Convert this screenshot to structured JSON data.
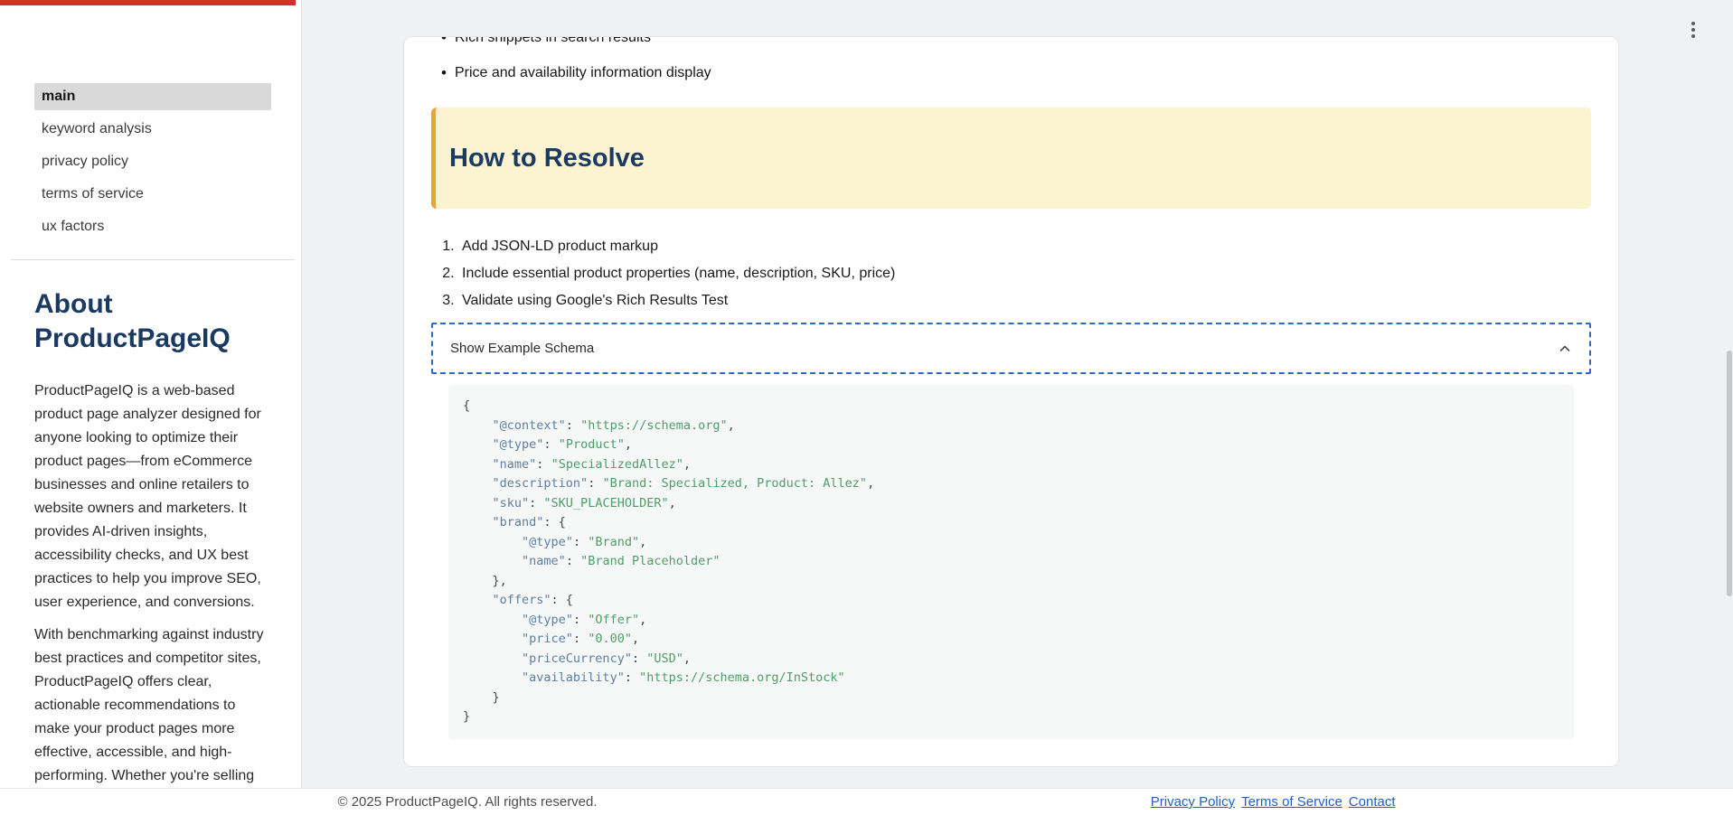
{
  "colors": {
    "accent_red": "#d32f2f",
    "heading_navy": "#1b3a61",
    "callout_bg": "#fcf3d1",
    "callout_border": "#efa22d",
    "toggle_dashed_blue": "#2e6bc0",
    "code_key": "#5b80a5",
    "code_string": "#4f9e68",
    "link_blue": "#2160c4"
  },
  "sidebar": {
    "nav": [
      {
        "label": "main",
        "active": true
      },
      {
        "label": "keyword analysis",
        "active": false
      },
      {
        "label": "privacy policy",
        "active": false
      },
      {
        "label": "terms of service",
        "active": false
      },
      {
        "label": "ux factors",
        "active": false
      }
    ],
    "about_title": "About ProductPageIQ",
    "about_p1": "ProductPageIQ is a web-based product page analyzer designed for anyone looking to optimize their product pages—from eCommerce businesses and online retailers to website owners and marketers. It provides AI-driven insights, accessibility checks, and UX best practices to help you improve SEO, user experience, and conversions.",
    "about_p2": "With benchmarking against industry best practices and competitor sites, ProductPageIQ offers clear, actionable recommendations to make your product pages more effective, accessible, and high-performing. Whether you're selling"
  },
  "main": {
    "partial_bullet": "Rich snippets in search results",
    "visible_bullet": "Price and availability information display",
    "bullet_glyph": "•",
    "callout_title": "How to Resolve",
    "steps": [
      "Add JSON-LD product markup",
      "Include essential product properties (name, description, SKU, price)",
      "Validate using Google's Rich Results Test"
    ],
    "toggle_label": "Show Example Schema",
    "code": {
      "lines": [
        [
          [
            "p",
            "{"
          ]
        ],
        [
          [
            "w",
            "    "
          ],
          [
            "k",
            "\"@context\""
          ],
          [
            "p",
            ": "
          ],
          [
            "s",
            "\"https://schema.org\""
          ],
          [
            "p",
            ","
          ]
        ],
        [
          [
            "w",
            "    "
          ],
          [
            "k",
            "\"@type\""
          ],
          [
            "p",
            ": "
          ],
          [
            "s",
            "\"Product\""
          ],
          [
            "p",
            ","
          ]
        ],
        [
          [
            "w",
            "    "
          ],
          [
            "k",
            "\"name\""
          ],
          [
            "p",
            ": "
          ],
          [
            "s",
            "\"SpecializedAllez\""
          ],
          [
            "p",
            ","
          ]
        ],
        [
          [
            "w",
            "    "
          ],
          [
            "k",
            "\"description\""
          ],
          [
            "p",
            ": "
          ],
          [
            "s",
            "\"Brand: Specialized, Product: Allez\""
          ],
          [
            "p",
            ","
          ]
        ],
        [
          [
            "w",
            "    "
          ],
          [
            "k",
            "\"sku\""
          ],
          [
            "p",
            ": "
          ],
          [
            "s",
            "\"SKU_PLACEHOLDER\""
          ],
          [
            "p",
            ","
          ]
        ],
        [
          [
            "w",
            "    "
          ],
          [
            "k",
            "\"brand\""
          ],
          [
            "p",
            ": {"
          ]
        ],
        [
          [
            "w",
            "        "
          ],
          [
            "k",
            "\"@type\""
          ],
          [
            "p",
            ": "
          ],
          [
            "s",
            "\"Brand\""
          ],
          [
            "p",
            ","
          ]
        ],
        [
          [
            "w",
            "        "
          ],
          [
            "k",
            "\"name\""
          ],
          [
            "p",
            ": "
          ],
          [
            "s",
            "\"Brand Placeholder\""
          ]
        ],
        [
          [
            "w",
            "    "
          ],
          [
            "p",
            "},"
          ]
        ],
        [
          [
            "w",
            "    "
          ],
          [
            "k",
            "\"offers\""
          ],
          [
            "p",
            ": {"
          ]
        ],
        [
          [
            "w",
            "        "
          ],
          [
            "k",
            "\"@type\""
          ],
          [
            "p",
            ": "
          ],
          [
            "s",
            "\"Offer\""
          ],
          [
            "p",
            ","
          ]
        ],
        [
          [
            "w",
            "        "
          ],
          [
            "k",
            "\"price\""
          ],
          [
            "p",
            ": "
          ],
          [
            "s",
            "\"0.00\""
          ],
          [
            "p",
            ","
          ]
        ],
        [
          [
            "w",
            "        "
          ],
          [
            "k",
            "\"priceCurrency\""
          ],
          [
            "p",
            ": "
          ],
          [
            "s",
            "\"USD\""
          ],
          [
            "p",
            ","
          ]
        ],
        [
          [
            "w",
            "        "
          ],
          [
            "k",
            "\"availability\""
          ],
          [
            "p",
            ": "
          ],
          [
            "s",
            "\"https://schema.org/InStock\""
          ]
        ],
        [
          [
            "w",
            "    "
          ],
          [
            "p",
            "}"
          ]
        ],
        [
          [
            "p",
            "}"
          ]
        ]
      ]
    }
  },
  "footer": {
    "copyright": "© 2025 ProductPageIQ. All rights reserved.",
    "links": [
      "Privacy Policy",
      "Terms of Service",
      "Contact"
    ]
  }
}
